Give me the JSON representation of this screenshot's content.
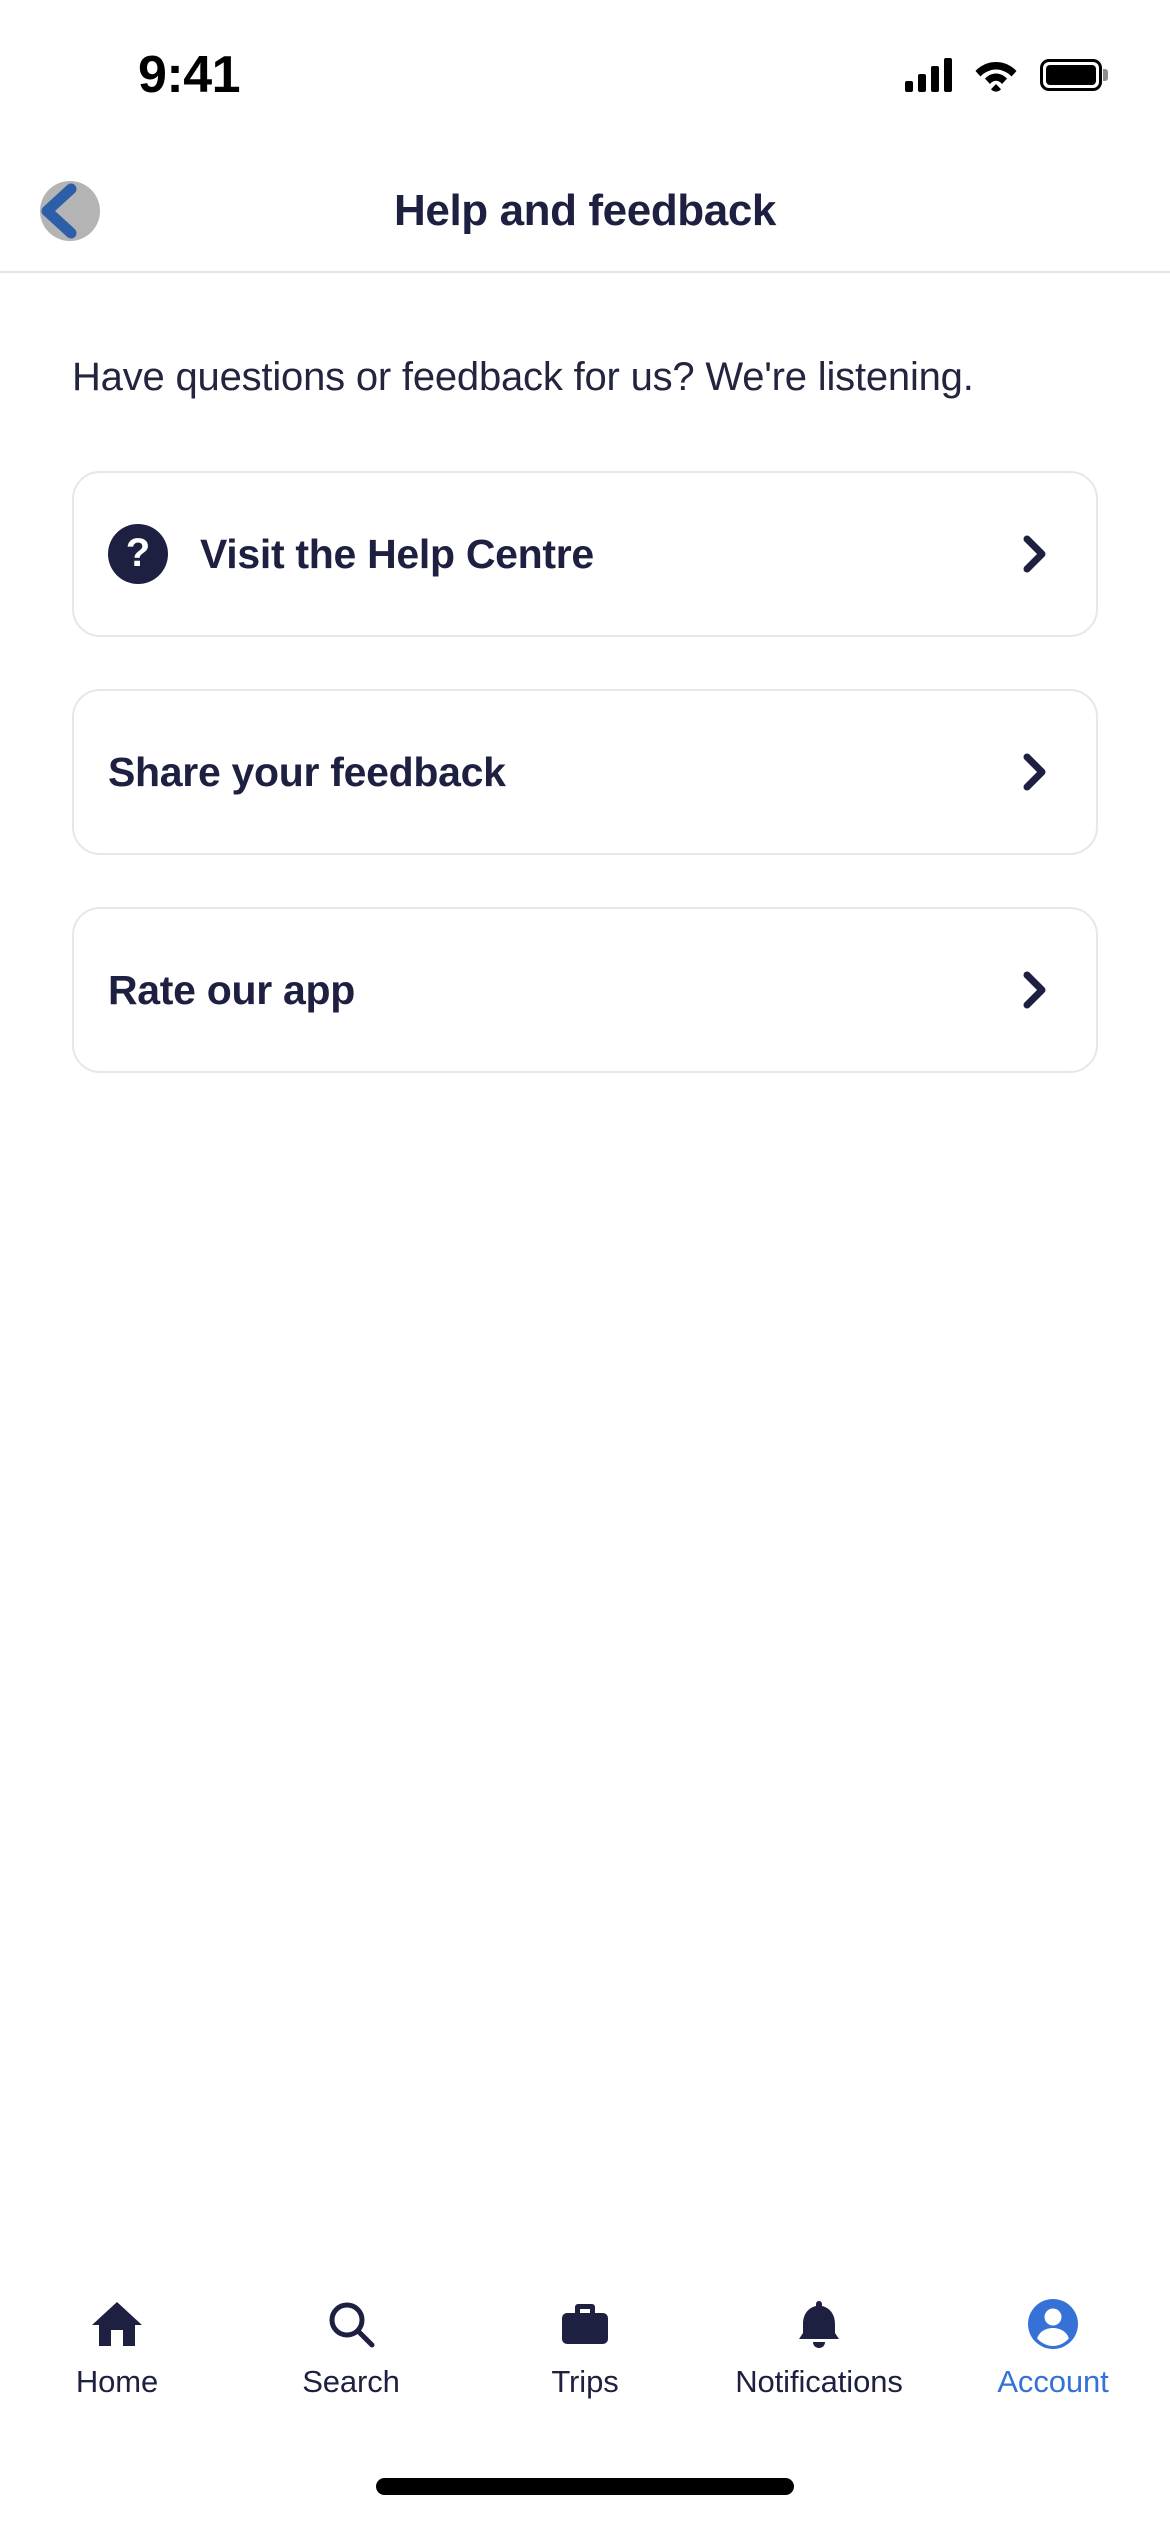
{
  "status_bar": {
    "time": "9:41",
    "cellular_icon": "signal-bars-icon",
    "wifi_icon": "wifi-icon",
    "battery_icon": "battery-full-icon"
  },
  "header": {
    "title": "Help and feedback",
    "back_icon": "chevron-left-icon"
  },
  "main": {
    "intro": "Have questions or feedback for us? We're listening.",
    "cards": [
      {
        "label": "Visit the Help Centre",
        "icon": "question-mark-circle-icon",
        "icon_glyph": "?",
        "chevron": "chevron-right-icon"
      },
      {
        "label": "Share your feedback",
        "icon": null,
        "chevron": "chevron-right-icon"
      },
      {
        "label": "Rate our app",
        "icon": null,
        "chevron": "chevron-right-icon"
      }
    ]
  },
  "tab_bar": {
    "active_index": 4,
    "items": [
      {
        "label": "Home",
        "icon": "home-icon"
      },
      {
        "label": "Search",
        "icon": "search-icon"
      },
      {
        "label": "Trips",
        "icon": "briefcase-icon"
      },
      {
        "label": "Notifications",
        "icon": "bell-icon"
      },
      {
        "label": "Account",
        "icon": "account-circle-icon"
      }
    ]
  },
  "colors": {
    "text_primary": "#1E2041",
    "accent_blue": "#3571D6",
    "card_border": "#E7E7EA",
    "divider": "#E4E4E7",
    "back_halo": "#B4B4B4",
    "back_chevron": "#2C5FA8"
  }
}
